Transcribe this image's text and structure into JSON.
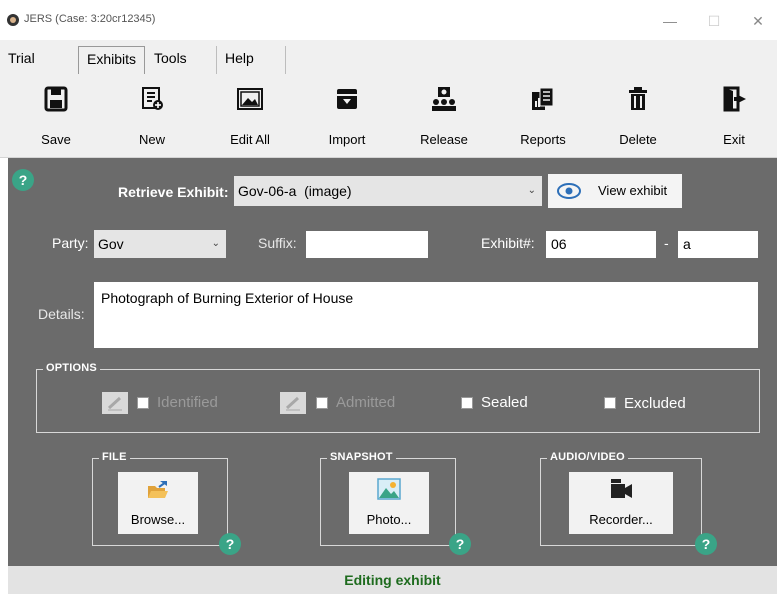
{
  "window": {
    "title": "JERS (Case: 3:20cr12345)",
    "minimize": "—",
    "maximize": "☐",
    "close": "✕"
  },
  "menu": {
    "tabs": [
      "Trial",
      "Exhibits",
      "Tools",
      "Help"
    ],
    "active": "Exhibits"
  },
  "toolbar": {
    "save": "Save",
    "new": "New",
    "edit_all": "Edit All",
    "import": "Import",
    "release": "Release",
    "reports": "Reports",
    "delete": "Delete",
    "exit": "Exit"
  },
  "form": {
    "retrieve_label": "Retrieve Exhibit:",
    "retrieve_value": "Gov-06-a  (image)",
    "view_button": "View exhibit",
    "party_label": "Party:",
    "party_value": "Gov",
    "suffix_label": "Suffix:",
    "suffix_value": "",
    "exhibit_num_label": "Exhibit#:",
    "exhibit_num_value": "06",
    "dash": "-",
    "exhibit_letter_value": "a",
    "details_label": "Details:",
    "details_value": "Photograph of Burning Exterior of House"
  },
  "options": {
    "title": "OPTIONS",
    "identified": "Identified",
    "admitted": "Admitted",
    "sealed": "Sealed",
    "excluded": "Excluded"
  },
  "file_group": {
    "title": "FILE",
    "button": "Browse..."
  },
  "snapshot_group": {
    "title": "SNAPSHOT",
    "button": "Photo..."
  },
  "av_group": {
    "title": "AUDIO/VIDEO",
    "button": "Recorder..."
  },
  "help_glyph": "?",
  "status": "Editing exhibit",
  "colors": {
    "panel": "#6b6b6b",
    "help": "#3aa487",
    "status_text": "#1e6b1e"
  }
}
